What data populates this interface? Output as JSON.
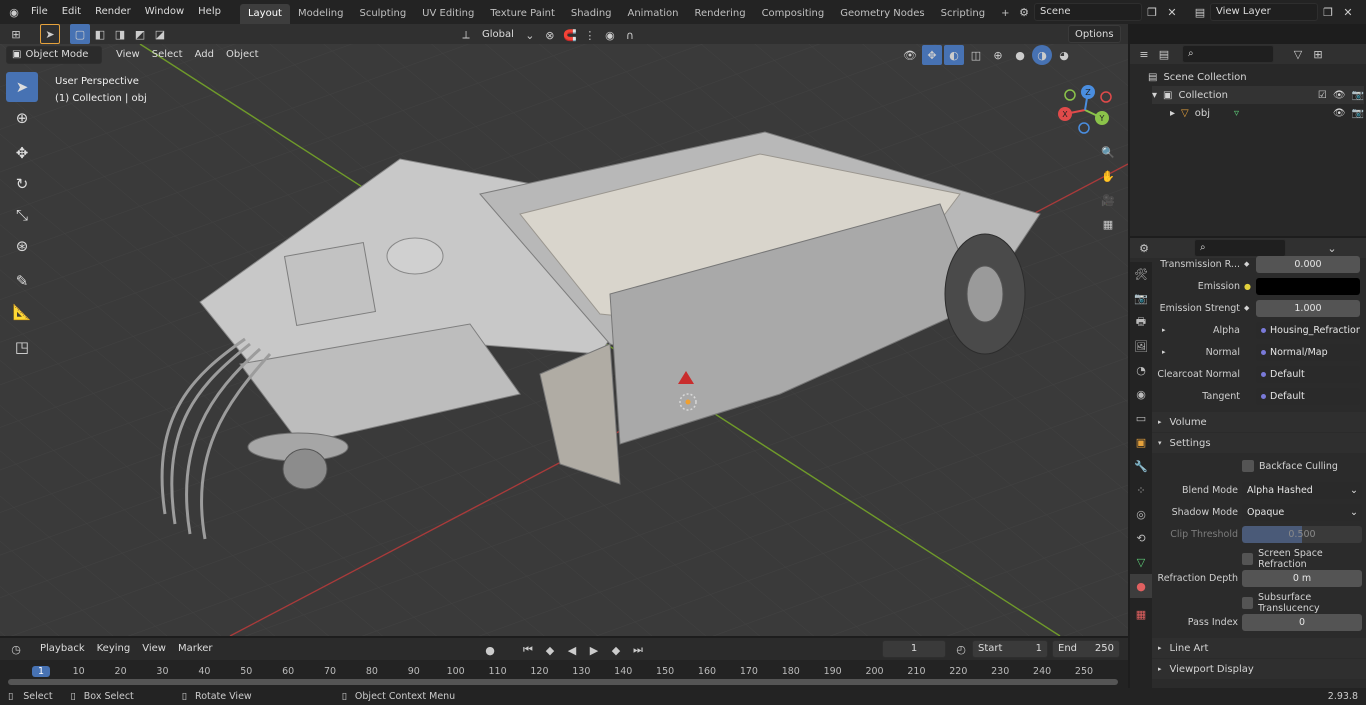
{
  "topbar": {
    "menus": [
      "File",
      "Edit",
      "Render",
      "Window",
      "Help"
    ],
    "workspaces": [
      "Layout",
      "Modeling",
      "Sculpting",
      "UV Editing",
      "Texture Paint",
      "Shading",
      "Animation",
      "Rendering",
      "Compositing",
      "Geometry Nodes",
      "Scripting"
    ],
    "active_workspace": "Layout",
    "add_tab": "+",
    "scene": "Scene",
    "view_layer": "View Layer"
  },
  "viewport": {
    "mode": "Object Mode",
    "menus": [
      "View",
      "Select",
      "Add",
      "Object"
    ],
    "orientation": "Global",
    "options": "Options",
    "perspective": "User Perspective",
    "collection_info": "(1) Collection | obj",
    "gizmo": {
      "x": "X",
      "y": "Y",
      "z": "Z"
    }
  },
  "outliner": {
    "search_placeholder": "",
    "scene_collection": "Scene Collection",
    "collection": "Collection",
    "object": "obj"
  },
  "properties": {
    "rows": [
      {
        "label": "Transmission R...",
        "value": "0.000",
        "type": "num"
      },
      {
        "label": "Emission",
        "value": "",
        "type": "color"
      },
      {
        "label": "Emission Strengt",
        "value": "1.000",
        "type": "num"
      },
      {
        "label": "Alpha",
        "value": "Housing_Refraction...",
        "type": "link"
      },
      {
        "label": "Normal",
        "value": "Normal/Map",
        "type": "link"
      },
      {
        "label": "Clearcoat Normal",
        "value": "Default",
        "type": "link"
      },
      {
        "label": "Tangent",
        "value": "Default",
        "type": "link"
      }
    ],
    "sections": {
      "volume": "Volume",
      "settings": "Settings",
      "line_art": "Line Art",
      "viewport_display": "Viewport Display"
    },
    "settings": {
      "backface_culling": "Backface Culling",
      "blend_mode_label": "Blend Mode",
      "blend_mode": "Alpha Hashed",
      "shadow_mode_label": "Shadow Mode",
      "shadow_mode": "Opaque",
      "clip_threshold_label": "Clip Threshold",
      "clip_threshold": "0.500",
      "clip_fill": 0.5,
      "ssr": "Screen Space Refraction",
      "refraction_depth_label": "Refraction Depth",
      "refraction_depth": "0 m",
      "subsurface": "Subsurface Translucency",
      "pass_index_label": "Pass Index",
      "pass_index": "0"
    }
  },
  "timeline": {
    "menus": [
      "Playback",
      "Keying",
      "View",
      "Marker"
    ],
    "current_frame": "1",
    "start_label": "Start",
    "start": "1",
    "end_label": "End",
    "end": "250",
    "frame_numbers": [
      "1",
      "10",
      "20",
      "30",
      "40",
      "50",
      "60",
      "70",
      "80",
      "90",
      "100",
      "110",
      "120",
      "130",
      "140",
      "150",
      "160",
      "170",
      "180",
      "190",
      "200",
      "210",
      "220",
      "230",
      "240",
      "250"
    ]
  },
  "statusbar": {
    "select": "Select",
    "box_select": "Box Select",
    "rotate_view": "Rotate View",
    "context_menu": "Object Context Menu",
    "version": "2.93.8"
  },
  "colors": {
    "accent": "#4772b3",
    "x_axis": "#e04a4a",
    "y_axis": "#8bc34a",
    "z_axis": "#4a8ee0"
  }
}
